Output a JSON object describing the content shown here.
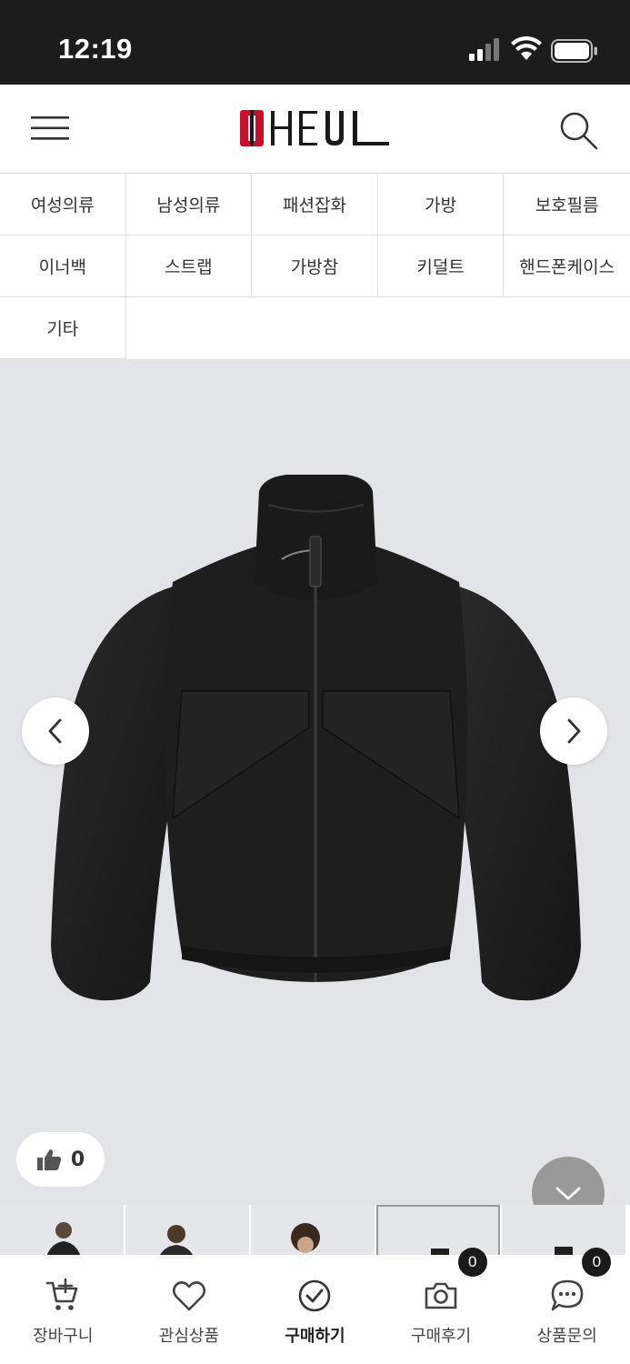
{
  "status_bar": {
    "time": "12:19"
  },
  "header": {
    "logo_text": "OHEUL",
    "logo_accent_color": "#c8102e"
  },
  "categories": {
    "rows": [
      [
        "여성의류",
        "남성의류",
        "패션잡화",
        "가방",
        "보호필름"
      ],
      [
        "이너백",
        "스트랩",
        "가방참",
        "키덜트",
        "핸드폰케이스"
      ],
      [
        "기타"
      ]
    ]
  },
  "gallery": {
    "product_image": "black-zip-up-jacket",
    "background_color": "#e2e4e8",
    "like_count": "0"
  },
  "bottom_bar": {
    "cart_label": "장바구니",
    "wishlist_label": "관심상품",
    "buy_label": "구매하기",
    "review_label": "구매후기",
    "review_count": "0",
    "qna_label": "상품문의",
    "qna_count": "0"
  }
}
